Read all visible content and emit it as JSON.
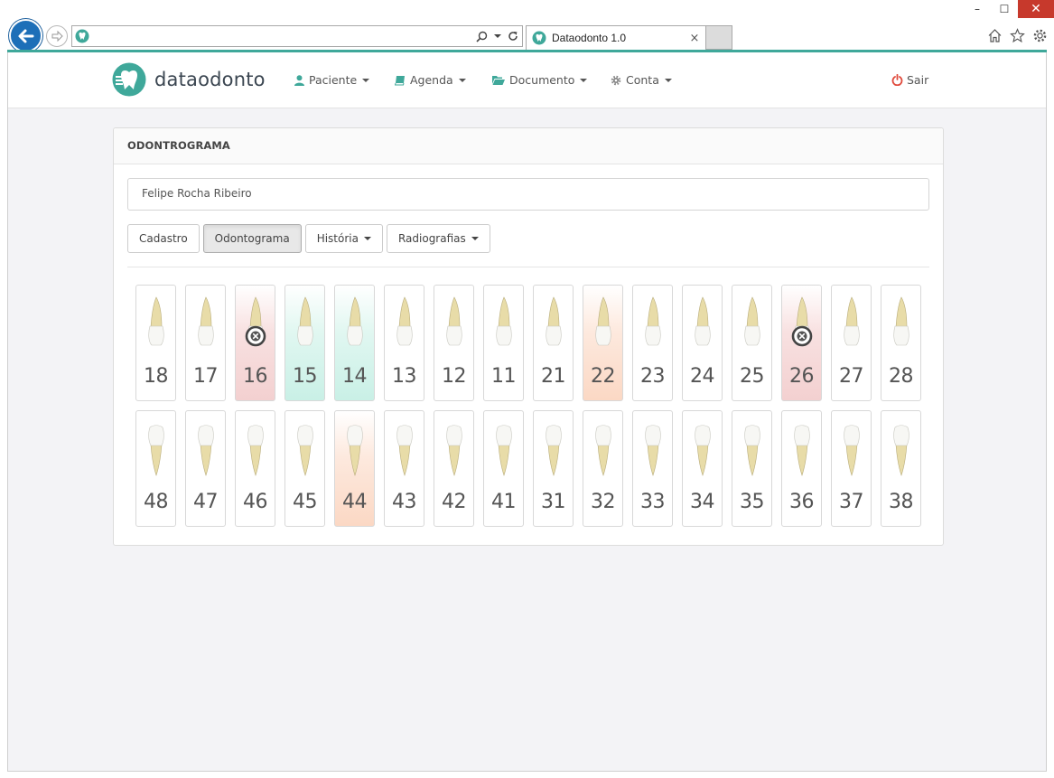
{
  "browser": {
    "tab_title": "Dataodonto 1.0",
    "tab_close": "×",
    "address": "",
    "window_controls": {
      "minimize": "–",
      "maximize": "☐",
      "close": "✕"
    }
  },
  "navbar": {
    "brand": "dataodonto",
    "items": [
      {
        "label": "Paciente",
        "icon": "user-icon"
      },
      {
        "label": "Agenda",
        "icon": "book-icon"
      },
      {
        "label": "Documento",
        "icon": "folder-open-icon"
      },
      {
        "label": "Conta",
        "icon": "gear-icon"
      }
    ],
    "logout": "Sair"
  },
  "panel": {
    "title": "ODONTROGRAMA",
    "patient_name": "Felipe Rocha Ribeiro",
    "buttons": [
      {
        "label": "Cadastro",
        "active": false,
        "dropdown": false
      },
      {
        "label": "Odontograma",
        "active": true,
        "dropdown": false
      },
      {
        "label": "História",
        "active": false,
        "dropdown": true
      },
      {
        "label": "Radiografias",
        "active": false,
        "dropdown": true
      }
    ]
  },
  "colors": {
    "accent": "#3fa89a",
    "logout": "#e04a3c",
    "status_red": "#f3d0d0",
    "status_green": "#c9f0e6",
    "status_orange": "#fbd8c4"
  },
  "teeth": {
    "upper": [
      {
        "number": "18",
        "status": "none",
        "missing": false
      },
      {
        "number": "17",
        "status": "none",
        "missing": false
      },
      {
        "number": "16",
        "status": "red",
        "missing": true
      },
      {
        "number": "15",
        "status": "green",
        "missing": false
      },
      {
        "number": "14",
        "status": "green",
        "missing": false
      },
      {
        "number": "13",
        "status": "none",
        "missing": false
      },
      {
        "number": "12",
        "status": "none",
        "missing": false
      },
      {
        "number": "11",
        "status": "none",
        "missing": false
      },
      {
        "number": "21",
        "status": "none",
        "missing": false
      },
      {
        "number": "22",
        "status": "orange",
        "missing": false
      },
      {
        "number": "23",
        "status": "none",
        "missing": false
      },
      {
        "number": "24",
        "status": "none",
        "missing": false
      },
      {
        "number": "25",
        "status": "none",
        "missing": false
      },
      {
        "number": "26",
        "status": "red",
        "missing": true
      },
      {
        "number": "27",
        "status": "none",
        "missing": false
      },
      {
        "number": "28",
        "status": "none",
        "missing": false
      }
    ],
    "lower": [
      {
        "number": "48",
        "status": "none",
        "missing": false
      },
      {
        "number": "47",
        "status": "none",
        "missing": false
      },
      {
        "number": "46",
        "status": "none",
        "missing": false
      },
      {
        "number": "45",
        "status": "none",
        "missing": false
      },
      {
        "number": "44",
        "status": "orange",
        "missing": false
      },
      {
        "number": "43",
        "status": "none",
        "missing": false
      },
      {
        "number": "42",
        "status": "none",
        "missing": false
      },
      {
        "number": "41",
        "status": "none",
        "missing": false
      },
      {
        "number": "31",
        "status": "none",
        "missing": false
      },
      {
        "number": "32",
        "status": "none",
        "missing": false
      },
      {
        "number": "33",
        "status": "none",
        "missing": false
      },
      {
        "number": "34",
        "status": "none",
        "missing": false
      },
      {
        "number": "35",
        "status": "none",
        "missing": false
      },
      {
        "number": "36",
        "status": "none",
        "missing": false
      },
      {
        "number": "37",
        "status": "none",
        "missing": false
      },
      {
        "number": "38",
        "status": "none",
        "missing": false
      }
    ]
  }
}
